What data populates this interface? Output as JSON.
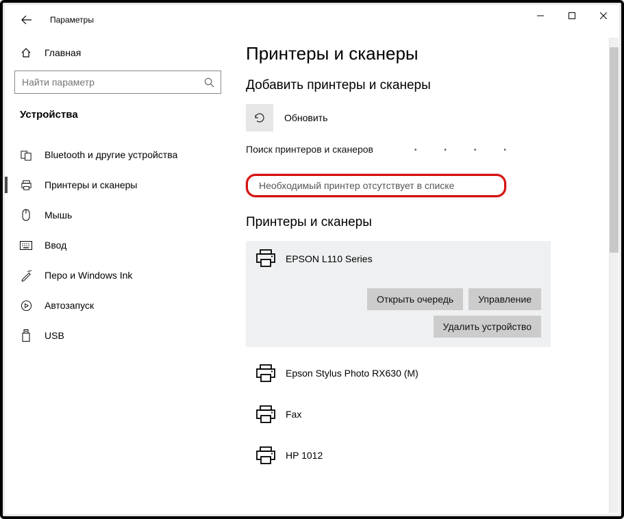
{
  "window": {
    "title": "Параметры"
  },
  "sidebar": {
    "home_label": "Главная",
    "search_placeholder": "Найти параметр",
    "category": "Устройства",
    "items": [
      {
        "label": "Bluetooth и другие устройства"
      },
      {
        "label": "Принтеры и сканеры"
      },
      {
        "label": "Мышь"
      },
      {
        "label": "Ввод"
      },
      {
        "label": "Перо и Windows Ink"
      },
      {
        "label": "Автозапуск"
      },
      {
        "label": "USB"
      }
    ]
  },
  "main": {
    "page_title": "Принтеры и сканеры",
    "add_section_title": "Добавить принтеры и сканеры",
    "refresh_label": "Обновить",
    "search_status": "Поиск принтеров и сканеров",
    "missing_link": "Необходимый принтер отсутствует в списке",
    "printers_section_title": "Принтеры и сканеры",
    "selected_printer": {
      "name": "EPSON L110 Series",
      "open_queue": "Открыть очередь",
      "manage": "Управление",
      "remove": "Удалить устройство"
    },
    "printers": [
      {
        "name": "Epson Stylus Photo RX630 (M)"
      },
      {
        "name": "Fax"
      },
      {
        "name": "HP 1012"
      }
    ]
  }
}
